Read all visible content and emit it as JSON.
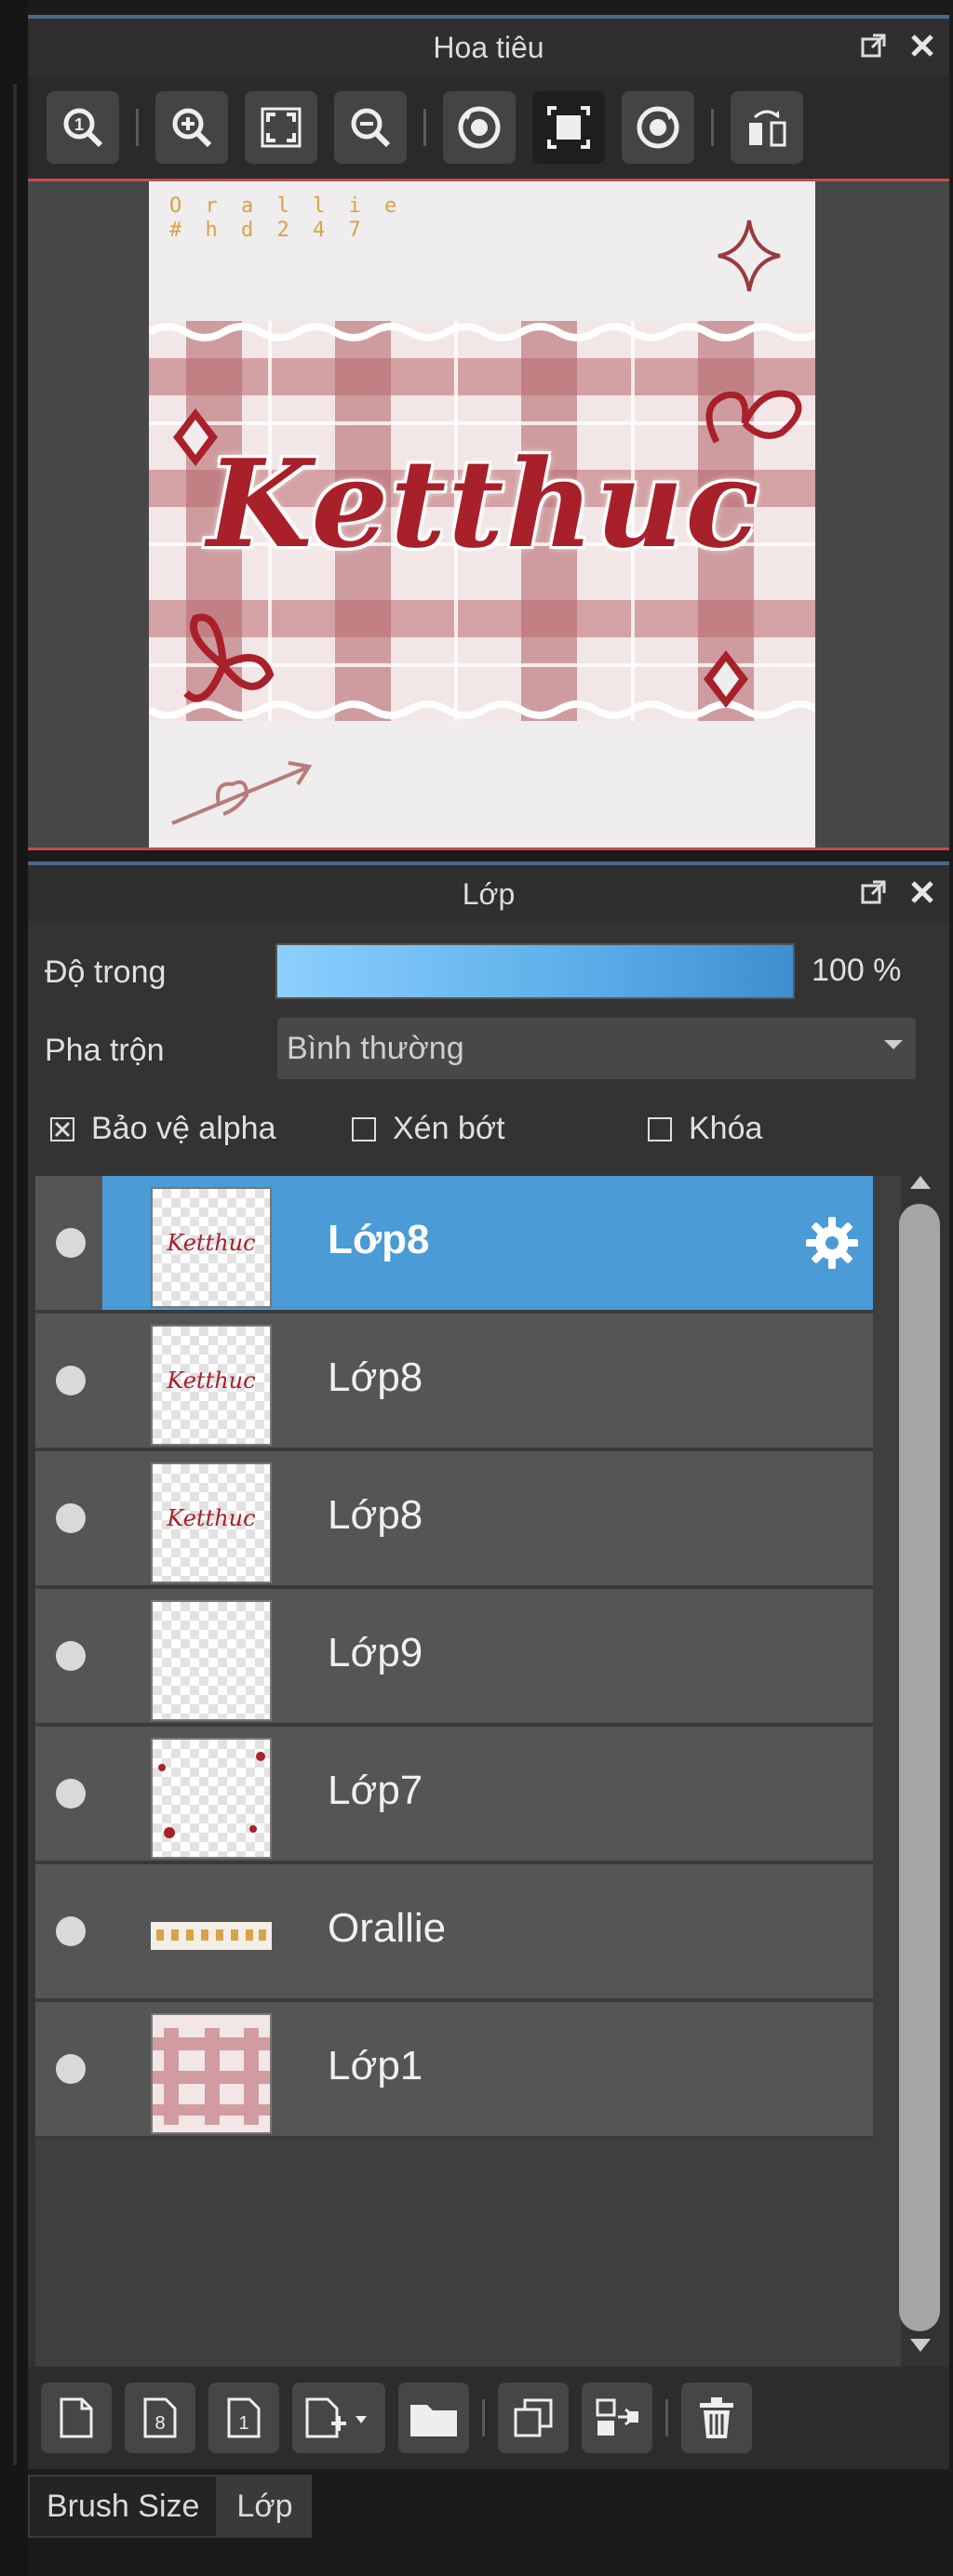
{
  "navigator": {
    "title": "Hoa tiêu",
    "toolbar": [
      "zoom-actual-icon",
      "zoom-in-icon",
      "fit-screen-icon",
      "zoom-out-icon",
      "rotate-left-icon",
      "fit-canvas-icon",
      "rotate-right-icon",
      "flip-horizontal-icon"
    ],
    "canvas": {
      "signature_line1": "O r a l l i e",
      "signature_line2": "# h d 2 4 7",
      "word": "Ketthuc"
    }
  },
  "layers_panel": {
    "title": "Lớp",
    "opacity_label": "Độ trong",
    "opacity_value": "100 %",
    "opacity_fraction": 1.0,
    "blend_label": "Pha trộn",
    "blend_value": "Bình thường",
    "checks": {
      "protect_alpha": {
        "label": "Bảo vệ alpha",
        "checked": true
      },
      "clipping": {
        "label": "Xén bớt",
        "checked": false
      },
      "lock": {
        "label": "Khóa",
        "checked": false
      }
    },
    "layers": [
      {
        "name": "Lớp8",
        "selected": true,
        "thumb_text": "Ketthuc"
      },
      {
        "name": "Lớp8",
        "selected": false,
        "thumb_text": "Ketthuc"
      },
      {
        "name": "Lớp8",
        "selected": false,
        "thumb_text": "Ketthuc"
      },
      {
        "name": "Lớp9",
        "selected": false,
        "thumb_text": ""
      },
      {
        "name": "Lớp7",
        "selected": false,
        "thumb_text": ""
      },
      {
        "name": "Orallie",
        "selected": false,
        "thumb_text": ""
      },
      {
        "name": "Lớp1",
        "selected": false,
        "thumb_text": ""
      }
    ],
    "bottom_tools": [
      "new-layer-icon",
      "new-8bit-layer-icon",
      "new-1bit-layer-icon",
      "add-layer-menu-icon",
      "new-folder-icon",
      "duplicate-layer-icon",
      "merge-down-icon",
      "delete-layer-icon"
    ]
  },
  "tabs": [
    {
      "label": "Brush Size",
      "active": false
    },
    {
      "label": "Lớp",
      "active": true
    }
  ],
  "colors": {
    "accent": "#4a9bd6",
    "border_red": "#c94a4a",
    "ink_red": "#a8202a"
  }
}
